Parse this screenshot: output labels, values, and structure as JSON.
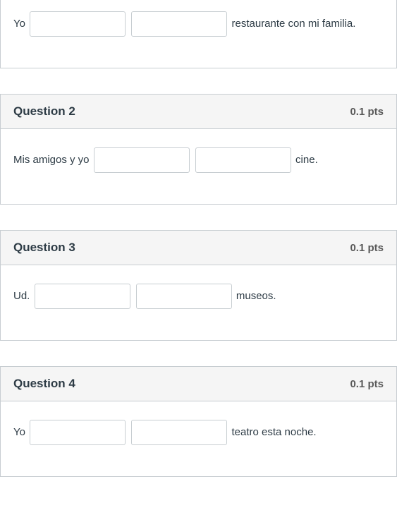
{
  "questions": [
    {
      "title": "",
      "points": "",
      "before": "Yo",
      "after": "restaurante con mi familia."
    },
    {
      "title": "Question 2",
      "points": "0.1 pts",
      "before": "Mis amigos y yo",
      "after": "cine."
    },
    {
      "title": "Question 3",
      "points": "0.1 pts",
      "before": "Ud.",
      "after": "museos."
    },
    {
      "title": "Question 4",
      "points": "0.1 pts",
      "before": "Yo",
      "after": "teatro esta noche."
    }
  ]
}
